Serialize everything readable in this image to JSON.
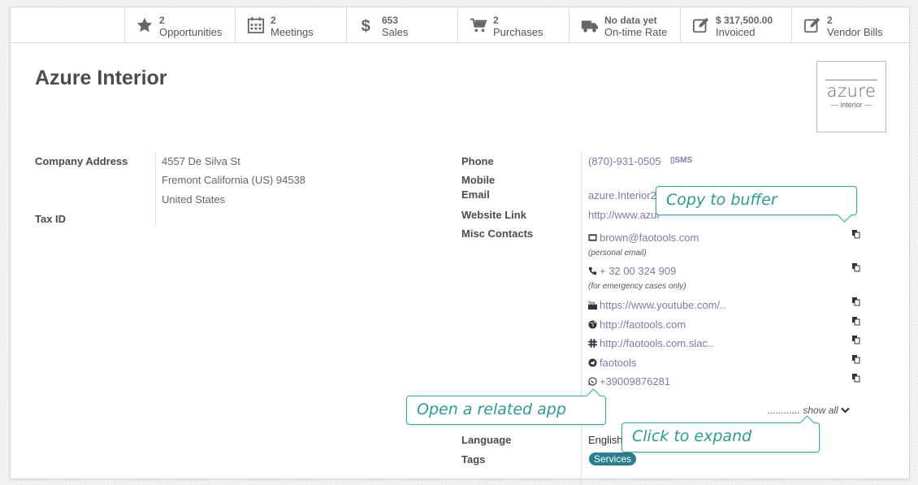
{
  "stats": [
    {
      "value": "2",
      "label": "Opportunities",
      "icon": "star-icon"
    },
    {
      "value": "2",
      "label": "Meetings",
      "icon": "calendar-icon"
    },
    {
      "value": "653",
      "label": "Sales",
      "icon": "dollar-icon"
    },
    {
      "value": "2",
      "label": "Purchases",
      "icon": "cart-icon"
    },
    {
      "value": "No data yet",
      "label": "On-time Rate",
      "icon": "truck-icon"
    },
    {
      "value": "$ 317,500.00",
      "label": "Invoiced",
      "icon": "edit-icon"
    },
    {
      "value": "2",
      "label": "Vendor Bills",
      "icon": "edit-icon"
    }
  ],
  "partner": {
    "name": "Azure Interior",
    "logo": {
      "word": "azure",
      "sub": "— interior —"
    }
  },
  "left_fields": {
    "company_address_label": "Company Address",
    "address_line1": "4557 De Silva St",
    "address_line2": "Fremont  California (US)  94538",
    "address_line3": "United States",
    "tax_id_label": "Tax ID"
  },
  "right_fields": {
    "phone_label": "Phone",
    "phone_value": "(870)-931-0505",
    "sms_label": "SMS",
    "mobile_label": "Mobile",
    "email_label": "Email",
    "email_value": "azure.Interior24",
    "website_label": "Website Link",
    "website_value": "http://www.azur",
    "misc_label": "Misc Contacts",
    "language_label": "Language",
    "language_value": "English",
    "tags_label": "Tags",
    "tag_value": "Services"
  },
  "misc_contacts": [
    {
      "icon": "envelope-icon",
      "text": "brown@faotools.com",
      "note": "(personal email)"
    },
    {
      "icon": "phone-icon",
      "text": "+ 32 00 324 909",
      "note": "(for emergency cases only)"
    },
    {
      "icon": "youtube-icon",
      "text": "https://www.youtube.com/.."
    },
    {
      "icon": "globe-icon",
      "text": "http://faotools.com"
    },
    {
      "icon": "slack-icon",
      "text": "http://faotools.com.slac.."
    },
    {
      "icon": "telegram-icon",
      "text": "faotools"
    },
    {
      "icon": "whatsapp-icon",
      "text": "+39009876281"
    }
  ],
  "show_all_label": "............ show all",
  "tooltips": {
    "copy": "Copy to buffer",
    "related": "Open a related app",
    "expand": "Click to expand"
  },
  "colors": {
    "accent": "#7c7bad",
    "tooltip": "#35a79c",
    "tag": "#2a7e8e"
  }
}
